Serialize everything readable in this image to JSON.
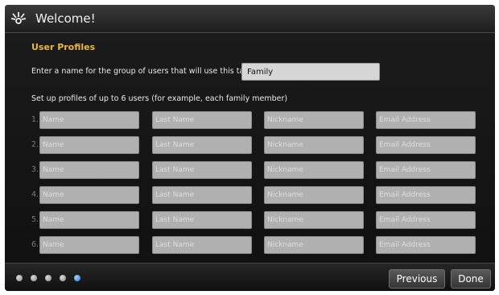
{
  "window": {
    "title": "Welcome!",
    "app_icon": "sprout-logo-icon"
  },
  "section": {
    "title": "User Profiles"
  },
  "group": {
    "prompt": "Enter a name for the group of users that will use this tablet:",
    "value": "Family"
  },
  "profiles": {
    "prompt": "Set up profiles of up to 6 users (for example, each family member)",
    "placeholders": {
      "first_name": "Name",
      "last_name": "Last Name",
      "nickname": "Nickname",
      "email": "Email Address"
    },
    "rows": [
      {
        "num": "1."
      },
      {
        "num": "2."
      },
      {
        "num": "3."
      },
      {
        "num": "4."
      },
      {
        "num": "5."
      },
      {
        "num": "6."
      }
    ]
  },
  "pager": {
    "total": 5,
    "current": 5
  },
  "buttons": {
    "previous": "Previous",
    "done": "Done"
  },
  "colors": {
    "accent": "#e8b64a",
    "active_dot": "#2a7fd4"
  }
}
